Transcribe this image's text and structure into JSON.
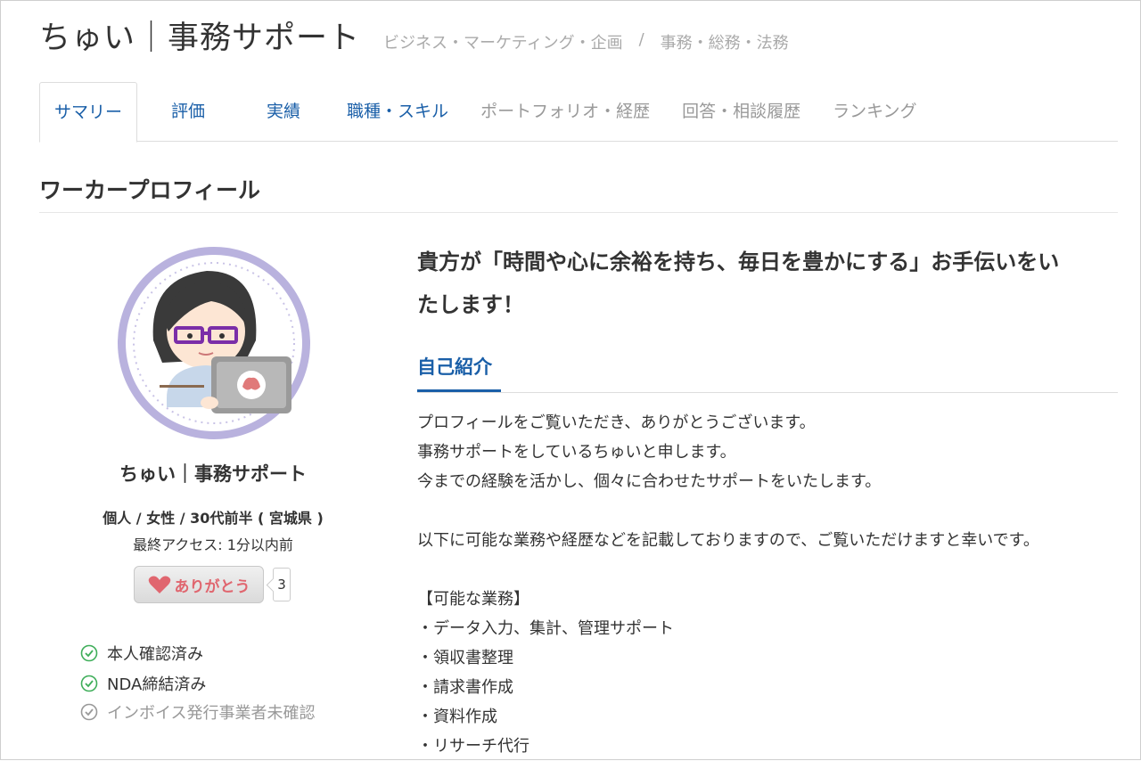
{
  "header": {
    "title": "ちゅい｜事務サポート",
    "breadcrumb": [
      "ビジネス・マーケティング・企画",
      "/",
      "事務・総務・法務"
    ]
  },
  "tabs": [
    "サマリー",
    "評価",
    "実績",
    "職種・スキル",
    "ポートフォリオ・経歴",
    "回答・相談履歴",
    "ランキング"
  ],
  "section": {
    "heading": "ワーカープロフィール"
  },
  "profile": {
    "name": "ちゅい｜事務サポート",
    "meta": "個人 / 女性 / 30代前半 ( 宮城県 )",
    "last_access": "最終アクセス: 1分以内前",
    "thanks_label": "ありがとう",
    "thanks_count": "3",
    "verifications": [
      "本人確認済み",
      "NDA締結済み",
      "インボイス発行事業者未確認"
    ]
  },
  "main": {
    "catchcopy_line1": "貴方が「時間や心に余裕を持ち、毎日を豊かにする」お手伝いをい",
    "catchcopy_line2": "たします！",
    "intro_tab": "自己紹介",
    "intro_lines": [
      "プロフィールをご覧いただき、ありがとうございます。",
      "事務サポートをしているちゅいと申します。",
      "今までの経験を活かし、個々に合わせたサポートをいたします。",
      "",
      "以下に可能な業務や経歴などを記載しておりますので、ご覧いただけますと幸いです。",
      "",
      "【可能な業務】",
      "・データ入力、集計、管理サポート",
      "・領収書整理",
      "・請求書作成",
      "・資料作成",
      "・リサーチ代行"
    ]
  },
  "colors": {
    "link": "#1a5fa8",
    "muted": "#999999",
    "check_green": "#3fae5a",
    "heart": "#e0666f",
    "avatar_ring": "#b9b2de"
  },
  "icons": {
    "verified": "check-circle-icon",
    "unverified": "check-circle-gray-icon",
    "heart": "heart-icon"
  }
}
